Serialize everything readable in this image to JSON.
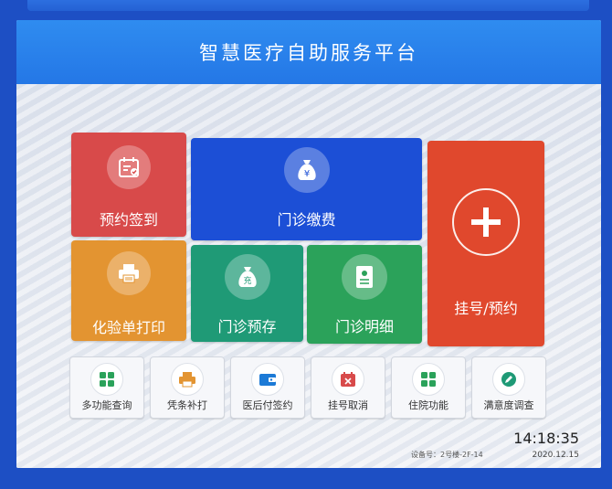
{
  "header": {
    "title": "智慧医疗自助服务平台"
  },
  "tiles": {
    "appointment_checkin": "预约签到",
    "outpatient_payment": "门诊缴费",
    "lab_report_print": "化验单打印",
    "outpatient_deposit": "门诊预存",
    "outpatient_details": "门诊明细",
    "registration": "挂号/预约",
    "deposit_icon_text": "充"
  },
  "small_buttons": [
    {
      "label": "多功能查询",
      "icon": "grid-icon"
    },
    {
      "label": "凭条补打",
      "icon": "printer-icon"
    },
    {
      "label": "医后付签约",
      "icon": "wallet-icon"
    },
    {
      "label": "挂号取消",
      "icon": "calendar-cancel-icon"
    },
    {
      "label": "住院功能",
      "icon": "grid-icon"
    },
    {
      "label": "满意度调查",
      "icon": "pen-icon"
    }
  ],
  "footer": {
    "time": "14:18:35",
    "date": "2020.12.15",
    "device": "设备号：2号楼-2F-14"
  },
  "colors": {
    "header": "#2477e6",
    "tile_red": "#d84a4a",
    "tile_blue": "#1c4fd6",
    "tile_orange": "#e39431",
    "tile_teal": "#1f9a76",
    "tile_green": "#2ba25a",
    "tile_big_red": "#e0482d"
  }
}
